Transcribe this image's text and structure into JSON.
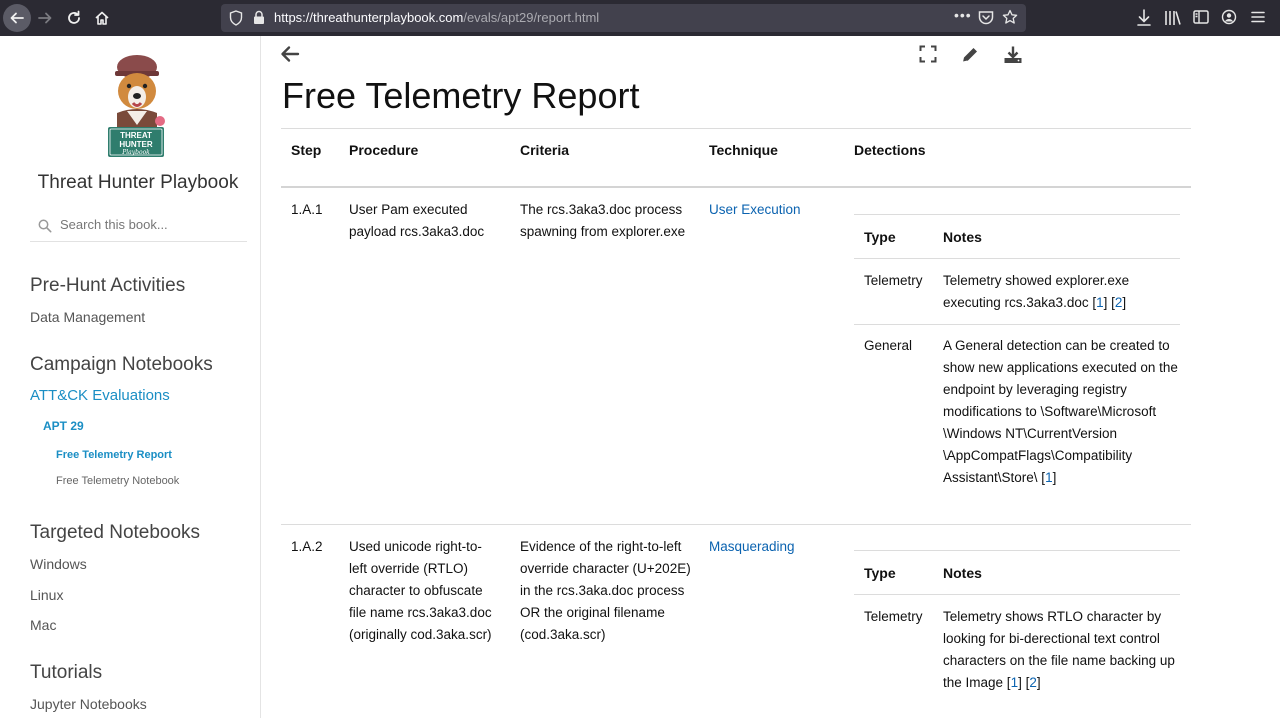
{
  "browser": {
    "url_host": "https://threathunterplaybook.com",
    "url_path": "/evals/apt29/report.html"
  },
  "sidebar": {
    "title": "Threat Hunter Playbook",
    "logo_text": [
      "THREAT",
      "HUNTER",
      "Playbook"
    ],
    "search_placeholder": "Search this book...",
    "sections": [
      {
        "label": "Pre-Hunt Activities",
        "items": [
          "Data Management"
        ]
      },
      {
        "label": "Campaign Notebooks",
        "active_item": "ATT&CK Evaluations",
        "sub_item": "APT 29",
        "sub_items": [
          "Free Telemetry Report",
          "Free Telemetry Notebook"
        ]
      },
      {
        "label": "Targeted Notebooks",
        "items": [
          "Windows",
          "Linux",
          "Mac"
        ]
      },
      {
        "label": "Tutorials",
        "items": [
          "Jupyter Notebooks"
        ]
      }
    ]
  },
  "main": {
    "title": "Free Telemetry Report",
    "headers": [
      "Step",
      "Procedure",
      "Criteria",
      "Technique",
      "Detections"
    ],
    "rows": [
      {
        "step": "1.A.1",
        "procedure": [
          "User Pam executed",
          "payload rcs.3aka3.doc"
        ],
        "criteria": [
          "The rcs.3aka3.doc process",
          "spawning from explorer.exe"
        ],
        "technique": "User Execution",
        "detections": {
          "headers": [
            "Type",
            "Notes"
          ],
          "rows": [
            {
              "type": "Telemetry",
              "notes": [
                "Telemetry showed explorer.exe",
                "executing rcs.3aka3.doc"
              ],
              "refs": [
                "1",
                "2"
              ]
            },
            {
              "type": "General",
              "notes": [
                "A General detection can be created to",
                "show new applications executed on the",
                "endpoint by leveraging registry",
                "modifications to \\Software\\Microsoft",
                "\\Windows NT\\CurrentVersion",
                "\\AppCompatFlags\\Compatibility",
                "Assistant\\Store\\"
              ],
              "refs": [
                "1"
              ]
            }
          ]
        }
      },
      {
        "step": "1.A.2",
        "procedure": [
          "Used unicode right-to-",
          "left override (RTLO)",
          "character to obfuscate",
          "file name rcs.3aka3.doc",
          "(originally cod.3aka.scr)"
        ],
        "criteria": [
          "Evidence of the right-to-left",
          "override character (U+202E)",
          "in the rcs.3aka.doc process",
          "OR the original filename",
          "(cod.3aka.scr)"
        ],
        "technique": "Masquerading",
        "detections": {
          "headers": [
            "Type",
            "Notes"
          ],
          "rows": [
            {
              "type": "Telemetry",
              "notes": [
                "Telemetry shows RTLO character by",
                "looking for bi-derectional text control",
                "characters on the file name backing up",
                "the Image"
              ],
              "refs": [
                "1",
                "2"
              ]
            }
          ]
        }
      }
    ]
  },
  "colors": {
    "link": "#0b63b0",
    "nav_active": "#1a8ec4",
    "chrome_bg": "#2b2a33"
  }
}
